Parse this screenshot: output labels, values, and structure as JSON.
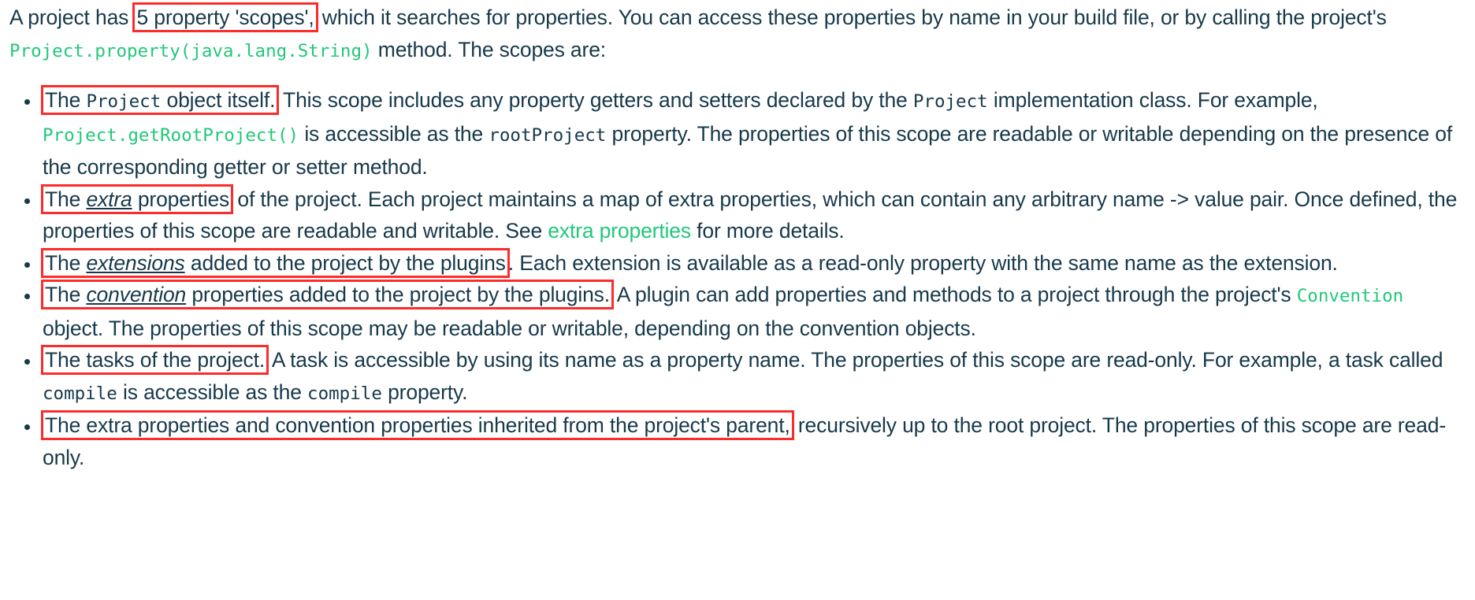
{
  "document": {
    "intro": {
      "part1": "A project has ",
      "highlight": "5 property 'scopes',",
      "part2": " which it searches for properties. You can access these properties by name in your build file, or by calling the project's ",
      "code": "Project.property(java.lang.String)",
      "part3": " method. The scopes are:"
    },
    "bullets": [
      {
        "id": "project-object",
        "highlight_pre": "The ",
        "highlight_code": "Project",
        "highlight_post": " object itself.",
        "body_1": " This scope includes any property getters and setters declared by the ",
        "body_code_1": "Project",
        "body_2": " implementation class. For example, ",
        "body_code_2": "Project.getRootProject()",
        "body_3": " is accessible as the ",
        "body_code_3": "rootProject",
        "body_4": " property. The properties of this scope are readable or writable depending on the presence of the corresponding getter or setter method."
      },
      {
        "id": "extra-properties",
        "highlight_pre": "The ",
        "highlight_emph": "extra",
        "highlight_post": " properties",
        "body_1": " of the project. Each project maintains a map of extra properties, which can contain any arbitrary name -> value pair. Once defined, the properties of this scope are readable and writable. See ",
        "link": "extra properties",
        "body_2": " for more details."
      },
      {
        "id": "extensions",
        "highlight_pre": "The ",
        "highlight_emph": "extensions",
        "highlight_post": " added to the project by the plugins",
        "body_1": ". Each extension is available as a read-only property with the same name as the extension."
      },
      {
        "id": "convention-properties",
        "highlight_pre": "The ",
        "highlight_emph": "convention",
        "highlight_post": " properties added to the project by the plugins.",
        "body_1": " A plugin can add properties and methods to a project through the project's ",
        "body_code_1": "Convention",
        "body_2": " object. The properties of this scope may be readable or writable, depending on the convention objects."
      },
      {
        "id": "tasks",
        "highlight_pre": "",
        "highlight_post": "The tasks of the project.",
        "body_1": " A task is accessible by using its name as a property name. The properties of this scope are read-only. For example, a task called ",
        "body_code_1": "compile",
        "body_2": " is accessible as the ",
        "body_code_2": "compile",
        "body_3": " property."
      },
      {
        "id": "inherited",
        "highlight_pre": "",
        "highlight_post": "The extra properties and convention properties inherited from the project's parent,",
        "body_1": " recursively up to the root project. The properties of this scope are read-only."
      }
    ]
  },
  "colors": {
    "text": "#17394a",
    "code_green": "#21c87a",
    "link_green": "#21c87a",
    "annotation_red": "#fb2c2c",
    "background": "#ffffff"
  }
}
